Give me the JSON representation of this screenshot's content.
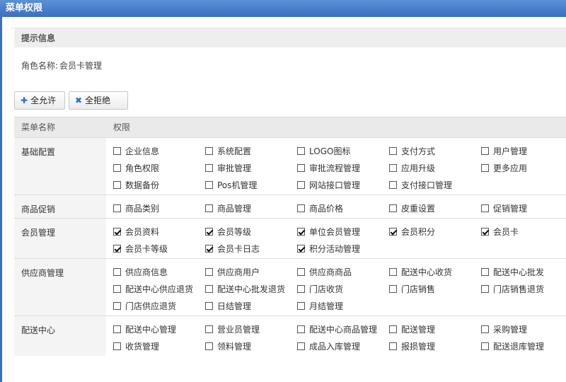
{
  "window": {
    "title": "菜单权限"
  },
  "info": {
    "heading": "提示信息",
    "role_label": "角色名称:",
    "role_value": "会员卡管理"
  },
  "buttons": {
    "allow_all": "全允许",
    "deny_all": "全拒绝"
  },
  "table": {
    "headers": {
      "menu": "菜单名称",
      "perm": "权限"
    },
    "groups": [
      {
        "name": "基础配置",
        "perms": [
          {
            "label": "企业信息",
            "checked": false
          },
          {
            "label": "系统配置",
            "checked": false
          },
          {
            "label": "LOGO图标",
            "checked": false
          },
          {
            "label": "支付方式",
            "checked": false
          },
          {
            "label": "用户管理",
            "checked": false
          },
          {
            "label": "角色权限",
            "checked": false
          },
          {
            "label": "审批管理",
            "checked": false
          },
          {
            "label": "审批流程管理",
            "checked": false
          },
          {
            "label": "应用升级",
            "checked": false
          },
          {
            "label": "更多应用",
            "checked": false
          },
          {
            "label": "数据备份",
            "checked": false
          },
          {
            "label": "Pos机管理",
            "checked": false
          },
          {
            "label": "网站接口管理",
            "checked": false
          },
          {
            "label": "支付接口管理",
            "checked": false
          }
        ]
      },
      {
        "name": "商品促销",
        "perms": [
          {
            "label": "商品类别",
            "checked": false
          },
          {
            "label": "商品管理",
            "checked": false
          },
          {
            "label": "商品价格",
            "checked": false
          },
          {
            "label": "皮重设置",
            "checked": false
          },
          {
            "label": "促销管理",
            "checked": false
          }
        ]
      },
      {
        "name": "会员管理",
        "perms": [
          {
            "label": "会员资料",
            "checked": true
          },
          {
            "label": "会员等级",
            "checked": true
          },
          {
            "label": "单位会员管理",
            "checked": true
          },
          {
            "label": "会员积分",
            "checked": true
          },
          {
            "label": "会员卡",
            "checked": true
          },
          {
            "label": "会员卡等级",
            "checked": true
          },
          {
            "label": "会员卡日志",
            "checked": true
          },
          {
            "label": "积分活动管理",
            "checked": true
          }
        ]
      },
      {
        "name": "供应商管理",
        "perms": [
          {
            "label": "供应商信息",
            "checked": false
          },
          {
            "label": "供应商用户",
            "checked": false
          },
          {
            "label": "供应商商品",
            "checked": false
          },
          {
            "label": "配送中心收货",
            "checked": false
          },
          {
            "label": "配送中心批发",
            "checked": false
          },
          {
            "label": "配送中心供应退货",
            "checked": false
          },
          {
            "label": "配送中心批发退货",
            "checked": false
          },
          {
            "label": "门店收货",
            "checked": false
          },
          {
            "label": "门店销售",
            "checked": false
          },
          {
            "label": "门店销售退货",
            "checked": false
          },
          {
            "label": "门店供应退货",
            "checked": false
          },
          {
            "label": "日结管理",
            "checked": false
          },
          {
            "label": "月结管理",
            "checked": false
          }
        ]
      },
      {
        "name": "配送中心",
        "perms": [
          {
            "label": "配送中心管理",
            "checked": false
          },
          {
            "label": "营业员管理",
            "checked": false
          },
          {
            "label": "配送中心商品管理",
            "checked": false
          },
          {
            "label": "配送管理",
            "checked": false
          },
          {
            "label": "采购管理",
            "checked": false
          },
          {
            "label": "收货管理",
            "checked": false
          },
          {
            "label": "领料管理",
            "checked": false
          },
          {
            "label": "成品入库管理",
            "checked": false
          },
          {
            "label": "报损管理",
            "checked": false
          },
          {
            "label": "配送退库管理",
            "checked": false
          }
        ]
      }
    ]
  }
}
